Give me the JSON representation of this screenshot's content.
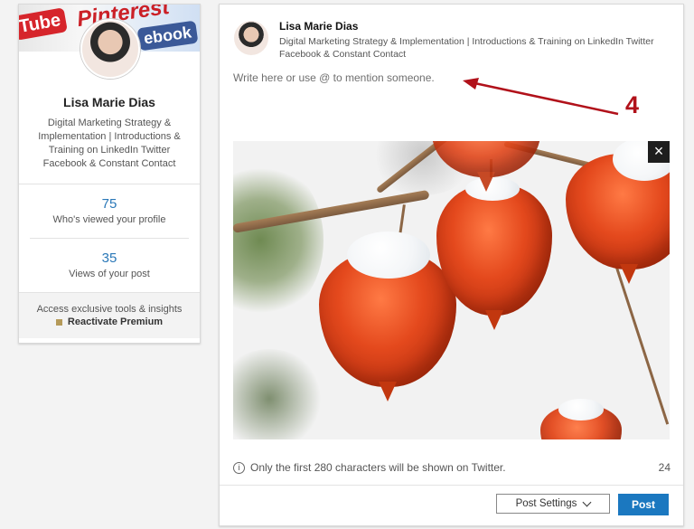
{
  "profile": {
    "name": "Lisa Marie Dias",
    "headline": "Digital Marketing Strategy & Implementation | Introductions & Training on LinkedIn Twitter Facebook & Constant Contact",
    "cover_texts": [
      "Tube",
      "Pinterest",
      "ebook"
    ],
    "stats": [
      {
        "value": "75",
        "label": "Who's viewed your profile"
      },
      {
        "value": "35",
        "label": "Views of your post"
      }
    ],
    "premium": {
      "text": "Access exclusive tools & insights",
      "cta": "Reactivate Premium"
    }
  },
  "composer": {
    "author_name": "Lisa Marie Dias",
    "author_headline": "Digital Marketing Strategy & Implementation | Introductions & Training on LinkedIn Twitter Facebook & Constant Contact",
    "placeholder": "Write here or use @ to mention someone.",
    "close_icon": "×",
    "twitter_notice": "Only the first 280 characters will be shown on Twitter.",
    "info_icon": "i",
    "char_count": "24",
    "post_settings_label": "Post Settings",
    "post_label": "Post"
  },
  "annotation": {
    "number": "4",
    "color": "#b1111a"
  }
}
